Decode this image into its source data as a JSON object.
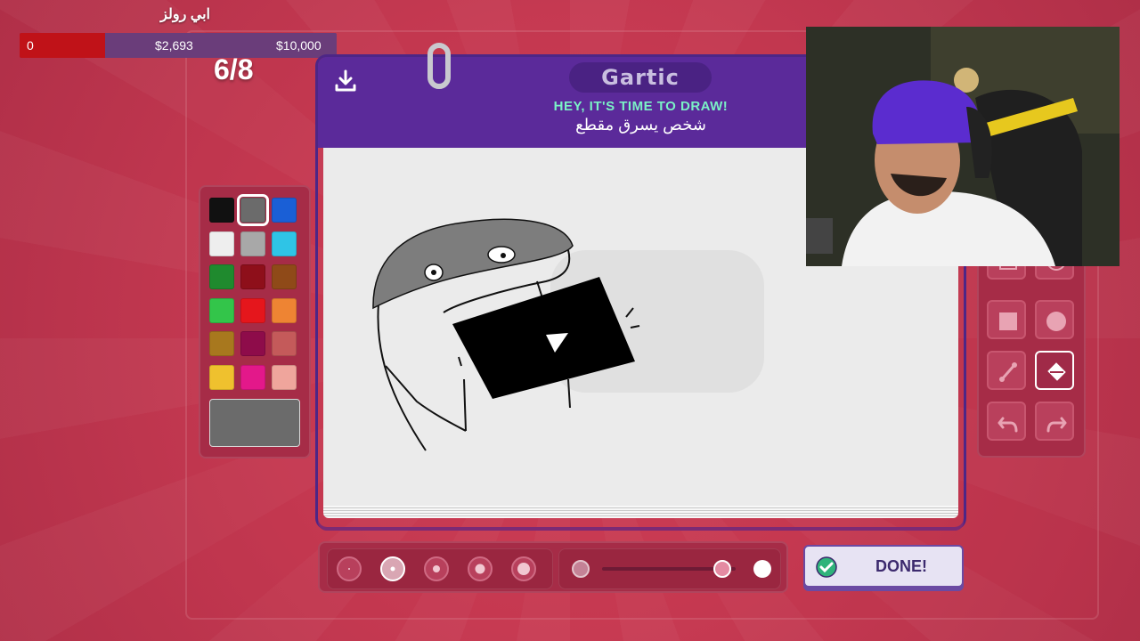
{
  "overlay": {
    "streamer_name": "ابي رولز",
    "money_left": "0",
    "money_mid": "$2,693",
    "money_right": "$10,000",
    "progress_fraction": 0.27
  },
  "game": {
    "round_counter": "6/8",
    "logo": "Gartic",
    "prompt_heading": "HEY, IT'S TIME TO DRAW!",
    "prompt_text": "شخص يسرق مقطع",
    "done_label": "DONE!"
  },
  "palette": {
    "colors": [
      "#111111",
      "#6b6b6b",
      "#1a5fd6",
      "#eeeeee",
      "#a8a8a8",
      "#2fc4e6",
      "#1f8a2e",
      "#8e0f1a",
      "#8f4a18",
      "#33c54a",
      "#e5161c",
      "#ee8433",
      "#a8781e",
      "#8e0c4a",
      "#c45a5a",
      "#efc12e",
      "#e3188a",
      "#efa59c"
    ],
    "selected_index": 1,
    "current_color": "#6b6b6b"
  },
  "tools": [
    "rectangle-outline-icon",
    "circle-outline-icon",
    "rectangle-filled-icon",
    "circle-filled-icon",
    "line-icon",
    "fill-bucket-icon",
    "undo-icon",
    "redo-icon"
  ],
  "brush_sizes": {
    "count": 5,
    "selected_index": 1
  },
  "opacity": {
    "value": 0.9
  },
  "colors": {
    "background": "#c73a52",
    "header": "#5b2a9a",
    "accent": "#7bf2c6"
  }
}
